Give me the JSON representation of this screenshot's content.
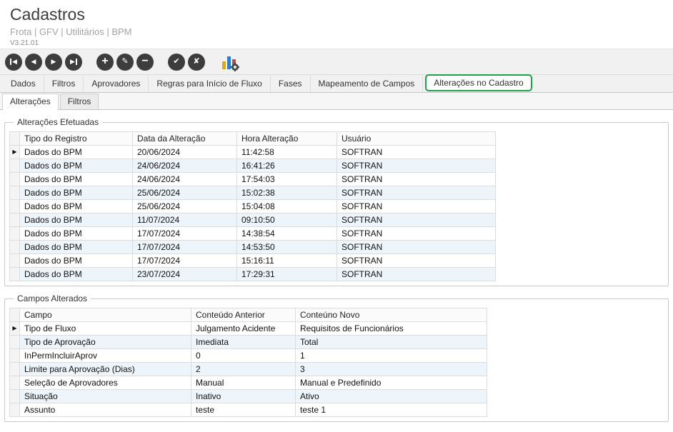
{
  "header": {
    "title": "Cadastros",
    "breadcrumb": "Frota | GFV | Utilitários | BPM",
    "version": "V3.21.01"
  },
  "toolbar": {
    "buttons": [
      {
        "name": "first-record",
        "glyph": "◀"
      },
      {
        "name": "prior-record",
        "glyph": "◀"
      },
      {
        "name": "next-record",
        "glyph": "▶"
      },
      {
        "name": "last-record",
        "glyph": "▶"
      },
      {
        "name": "insert-record",
        "glyph": "+"
      },
      {
        "name": "edit-record",
        "glyph": "✎"
      },
      {
        "name": "delete-record",
        "glyph": "−"
      },
      {
        "name": "confirm-record",
        "glyph": "✔"
      },
      {
        "name": "cancel-record",
        "glyph": "✘"
      }
    ],
    "chart_button": {
      "name": "chart-settings"
    }
  },
  "tabs": {
    "main": [
      "Dados",
      "Filtros",
      "Aprovadores",
      "Regras para Início de Fluxo",
      "Fases",
      "Mapeamento de Campos",
      "Alterações no Cadastro"
    ],
    "active_main": "Alterações no Cadastro",
    "sub": [
      "Alterações",
      "Filtros"
    ],
    "active_sub": "Alterações"
  },
  "icons": {
    "row_indicator": "▶"
  },
  "colors": {
    "highlight_green": "#1fa04b",
    "toolbar_icon": "#3d3d3d",
    "row_stripe": "#edf4fa"
  },
  "tables": {
    "alteracoes": {
      "legend": "Alterações Efetuadas",
      "columns": [
        "Tipo do Registro",
        "Data da Alteração",
        "Hora Alteração",
        "Usuário"
      ],
      "widths": [
        158,
        146,
        140,
        222
      ],
      "selected": 0,
      "rows": [
        [
          "Dados do BPM",
          "20/06/2024",
          "11:42:58",
          "SOFTRAN"
        ],
        [
          "Dados do BPM",
          "24/06/2024",
          "16:41:26",
          "SOFTRAN"
        ],
        [
          "Dados do BPM",
          "24/06/2024",
          "17:54:03",
          "SOFTRAN"
        ],
        [
          "Dados do BPM",
          "25/06/2024",
          "15:02:38",
          "SOFTRAN"
        ],
        [
          "Dados do BPM",
          "25/06/2024",
          "15:04:08",
          "SOFTRAN"
        ],
        [
          "Dados do BPM",
          "11/07/2024",
          "09:10:50",
          "SOFTRAN"
        ],
        [
          "Dados do BPM",
          "17/07/2024",
          "14:38:54",
          "SOFTRAN"
        ],
        [
          "Dados do BPM",
          "17/07/2024",
          "14:53:50",
          "SOFTRAN"
        ],
        [
          "Dados do BPM",
          "17/07/2024",
          "15:16:11",
          "SOFTRAN"
        ],
        [
          "Dados do BPM",
          "23/07/2024",
          "17:29:31",
          "SOFTRAN"
        ]
      ]
    },
    "campos": {
      "legend": "Campos Alterados",
      "columns": [
        "Campo",
        "Conteúdo Anterior",
        "Conteúno Novo"
      ],
      "widths": [
        240,
        146,
        268
      ],
      "selected": 0,
      "rows": [
        [
          "Tipo de Fluxo",
          "Julgamento Acidente",
          "Requisitos de Funcionários"
        ],
        [
          "Tipo de Aprovação",
          "Imediata",
          "Total"
        ],
        [
          "InPermIncluirAprov",
          "0",
          "1"
        ],
        [
          "Limite para Aprovação (Dias)",
          "2",
          "3"
        ],
        [
          "Seleção de Aprovadores",
          "Manual",
          "Manual e Predefinido"
        ],
        [
          "Situação",
          "Inativo",
          "Ativo"
        ],
        [
          "Assunto",
          "teste",
          "teste 1"
        ]
      ]
    }
  }
}
